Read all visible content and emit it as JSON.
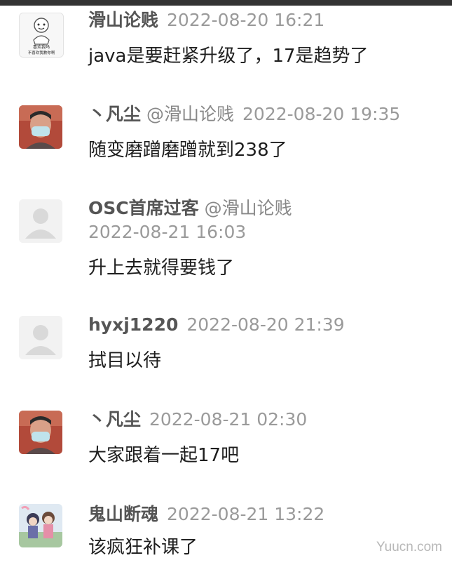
{
  "comments": [
    {
      "author": "滑山论贱",
      "reply_to": "",
      "time": "2022-08-20 16:21",
      "text": "java是要赶紧升级了，17是趋势了",
      "avatar_icon": "meme-avatar-icon",
      "avatar_text_1": "喜欢我吗",
      "avatar_text_2": "不喜欢我教你啊"
    },
    {
      "author": "丶凡尘",
      "reply_to": "@滑山论贱",
      "time": "2022-08-20 19:35",
      "text": "随变磨蹭磨蹭就到238了",
      "avatar_icon": "masked-person-avatar-icon"
    },
    {
      "author": "OSC首席过客",
      "reply_to": "@滑山论贱",
      "time": "2022-08-21 16:03",
      "text": "升上去就得要钱了",
      "avatar_icon": "default-user-avatar-icon"
    },
    {
      "author": "hyxj1220",
      "reply_to": "",
      "time": "2022-08-20 21:39",
      "text": "拭目以待",
      "avatar_icon": "default-user-avatar-icon"
    },
    {
      "author": "丶凡尘",
      "reply_to": "",
      "time": "2022-08-21 02:30",
      "text": "大家跟着一起17吧",
      "avatar_icon": "masked-person-avatar-icon"
    },
    {
      "author": "鬼山断魂",
      "reply_to": "",
      "time": "2022-08-21 13:22",
      "text": "该疯狂补课了",
      "avatar_icon": "anime-illustration-avatar-icon"
    }
  ],
  "watermark": "Yuucn.com"
}
